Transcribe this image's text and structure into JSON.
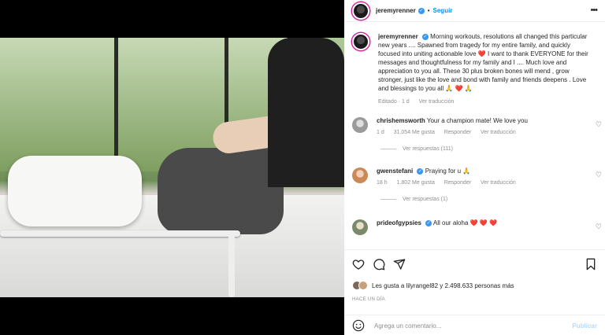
{
  "post": {
    "username": "jeremyrenner",
    "follow_label": "Seguir",
    "more_icon": "more-icon",
    "caption": "Morning workouts, resolutions all changed this particular new years .... Spawned from tragedy for my entire family, and quickly focused into uniting actionable love ❤️ I want to thank EVERYONE for their messages and thoughtfulness for my family and I .... Much love and appreciation to you all. These 30 plus broken bones will mend , grow stronger, just like the love and bond with family and friends deepens . Love and blessings to you all 🙏 ❤️ 🙏",
    "edited": "Editado · 1 d",
    "see_translation": "Ver traducción"
  },
  "comments": [
    {
      "username": "chrishemsworth",
      "text": "Your a champion mate! We love you",
      "age": "1 d",
      "likes": "31.054 Me gusta",
      "reply": "Responder",
      "translate": "Ver traducción",
      "view_replies": "Ver respuestas (111)"
    },
    {
      "username": "gwenstefani",
      "text": "Praying for u 🙏",
      "age": "18 h",
      "likes": "1.802 Me gusta",
      "reply": "Responder",
      "translate": "Ver traducción",
      "view_replies": "Ver respuestas (1)"
    },
    {
      "username": "prideofgypsies",
      "text": "All our aloha ❤️ ❤️ ❤️"
    }
  ],
  "engagement": {
    "likes_text": "Les gusta a lilyrangel82 y 2.498.633 personas más",
    "time_ago": "HACE UN DÍA"
  },
  "add_comment": {
    "placeholder": "Agrega un comentario...",
    "post_label": "Publicar"
  },
  "colors": {
    "accent": "#0095f6",
    "verified": "#3897f0",
    "muted": "#8e8e8e"
  }
}
